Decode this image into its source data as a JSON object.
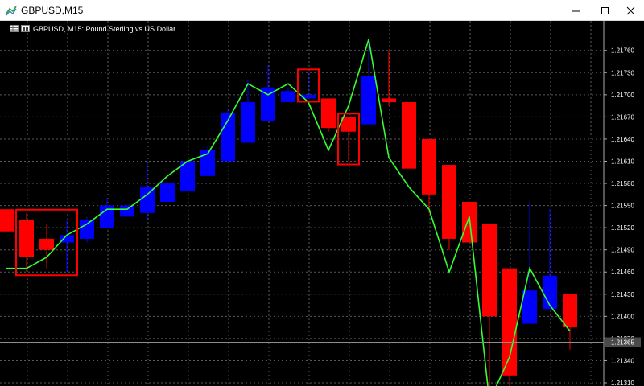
{
  "window": {
    "title": "GBPUSD,M15",
    "icon": "chart-line-icon"
  },
  "chart": {
    "header_label": "GBPUSD, M15:  Pound Sterling vs US Dollar",
    "header_icons": [
      "chart-grid-icon",
      "chart-settings-icon"
    ],
    "bid_label": "1.21365",
    "bid_line_color": "#8c8c8c",
    "bid_label_bg": "#4a4a4a",
    "grid_color": "#5a5a5a",
    "bull_color": "#0000ff",
    "bear_color": "#ff0000",
    "ma_color": "#33ff33",
    "highlight_color": "#ff0000"
  },
  "chart_data": {
    "type": "candlestick",
    "symbol": "GBPUSD",
    "timeframe": "M15",
    "description": "Pound Sterling vs US Dollar",
    "ylim": [
      1.2131,
      1.218
    ],
    "ytick_labels": [
      "1.21760",
      "1.21730",
      "1.21700",
      "1.21670",
      "1.21640",
      "1.21610",
      "1.21580",
      "1.21550",
      "1.21520",
      "1.21490",
      "1.21460",
      "1.21430",
      "1.21400",
      "1.21370",
      "1.21340",
      "1.21310"
    ],
    "candles": [
      {
        "open": 1.21545,
        "high": 1.21545,
        "low": 1.21515,
        "close": 1.21515
      },
      {
        "open": 1.2153,
        "high": 1.2154,
        "low": 1.2146,
        "close": 1.2148
      },
      {
        "open": 1.21505,
        "high": 1.21525,
        "low": 1.21465,
        "close": 1.2149
      },
      {
        "open": 1.215,
        "high": 1.2153,
        "low": 1.2146,
        "close": 1.2151
      },
      {
        "open": 1.21505,
        "high": 1.21535,
        "low": 1.215,
        "close": 1.2153
      },
      {
        "open": 1.2152,
        "high": 1.2156,
        "low": 1.2152,
        "close": 1.2155
      },
      {
        "open": 1.21535,
        "high": 1.2155,
        "low": 1.21535,
        "close": 1.2155
      },
      {
        "open": 1.2154,
        "high": 1.2161,
        "low": 1.2153,
        "close": 1.21575
      },
      {
        "open": 1.21555,
        "high": 1.21575,
        "low": 1.21555,
        "close": 1.2158
      },
      {
        "open": 1.2157,
        "high": 1.2161,
        "low": 1.2157,
        "close": 1.2161
      },
      {
        "open": 1.2159,
        "high": 1.2163,
        "low": 1.2159,
        "close": 1.21625
      },
      {
        "open": 1.2161,
        "high": 1.2168,
        "low": 1.2161,
        "close": 1.21675
      },
      {
        "open": 1.21635,
        "high": 1.2172,
        "low": 1.21635,
        "close": 1.2169
      },
      {
        "open": 1.21665,
        "high": 1.2174,
        "low": 1.21665,
        "close": 1.2171
      },
      {
        "open": 1.2169,
        "high": 1.2171,
        "low": 1.2169,
        "close": 1.21705
      },
      {
        "open": 1.21695,
        "high": 1.2173,
        "low": 1.21695,
        "close": 1.217
      },
      {
        "open": 1.21695,
        "high": 1.21695,
        "low": 1.2165,
        "close": 1.21655
      },
      {
        "open": 1.2167,
        "high": 1.2167,
        "low": 1.2161,
        "close": 1.2165
      },
      {
        "open": 1.2166,
        "high": 1.21775,
        "low": 1.2166,
        "close": 1.21725
      },
      {
        "open": 1.21695,
        "high": 1.2176,
        "low": 1.21685,
        "close": 1.2169
      },
      {
        "open": 1.2169,
        "high": 1.2169,
        "low": 1.216,
        "close": 1.216
      },
      {
        "open": 1.2164,
        "high": 1.2164,
        "low": 1.2154,
        "close": 1.21565
      },
      {
        "open": 1.21605,
        "high": 1.21605,
        "low": 1.2149,
        "close": 1.21505
      },
      {
        "open": 1.21555,
        "high": 1.21555,
        "low": 1.215,
        "close": 1.215
      },
      {
        "open": 1.21525,
        "high": 1.21525,
        "low": 1.2127,
        "close": 1.214
      },
      {
        "open": 1.21465,
        "high": 1.21465,
        "low": 1.2128,
        "close": 1.2132
      },
      {
        "open": 1.2139,
        "high": 1.21555,
        "low": 1.2139,
        "close": 1.21435
      },
      {
        "open": 1.2141,
        "high": 1.21545,
        "low": 1.2141,
        "close": 1.21455
      },
      {
        "open": 1.2143,
        "high": 1.2143,
        "low": 1.21355,
        "close": 1.21385
      }
    ],
    "moving_average": [
      1.21465,
      1.21465,
      1.2148,
      1.2151,
      1.21525,
      1.21545,
      1.21545,
      1.21565,
      1.2159,
      1.2161,
      1.2162,
      1.21665,
      1.21715,
      1.217,
      1.21715,
      1.2169,
      1.21625,
      1.21685,
      1.21775,
      1.21615,
      1.21575,
      1.21545,
      1.2146,
      1.21535,
      1.21285,
      1.21345,
      1.21465,
      1.21415,
      1.2138
    ],
    "highlight_boxes": [
      {
        "from_candle": 1,
        "to_candle": 3
      },
      {
        "from_candle": 15,
        "to_candle": 15
      },
      {
        "from_candle": 17,
        "to_candle": 17
      }
    ],
    "bid_price": 1.21365
  }
}
